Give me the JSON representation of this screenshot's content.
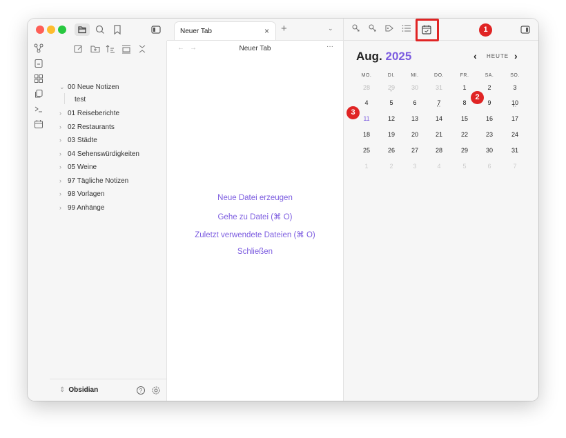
{
  "sidebar": {
    "vault_name": "Obsidian",
    "tree": [
      {
        "label": "00 Neue Notizen",
        "expanded": true
      },
      {
        "label": "test",
        "is_file": true
      },
      {
        "label": "01 Reiseberichte"
      },
      {
        "label": "02 Restaurants"
      },
      {
        "label": "03 Städte"
      },
      {
        "label": "04 Sehenswürdigkeiten"
      },
      {
        "label": "05 Weine"
      },
      {
        "label": "97 Tägliche Notizen"
      },
      {
        "label": "98 Vorlagen"
      },
      {
        "label": "99 Anhänge"
      }
    ]
  },
  "editor": {
    "tab_title": "Neuer Tab",
    "header_title": "Neuer Tab",
    "actions": [
      "Neue Datei erzeugen",
      "Gehe zu Datei (⌘ O)",
      "Zuletzt verwendete Dateien (⌘ O)",
      "Schließen"
    ]
  },
  "calendar": {
    "month": "Aug.",
    "year": "2025",
    "today_label": "HEUTE",
    "weekdays": [
      "MO.",
      "DI.",
      "MI.",
      "DO.",
      "FR.",
      "SA.",
      "SO."
    ],
    "weeks": [
      [
        "28",
        "29",
        "30",
        "31",
        "1",
        "2",
        "3"
      ],
      [
        "4",
        "5",
        "6",
        "7",
        "8",
        "9",
        "10"
      ],
      [
        "11",
        "12",
        "13",
        "14",
        "15",
        "16",
        "17"
      ],
      [
        "18",
        "19",
        "20",
        "21",
        "22",
        "23",
        "24"
      ],
      [
        "25",
        "26",
        "27",
        "28",
        "29",
        "30",
        "31"
      ],
      [
        "1",
        "2",
        "3",
        "4",
        "5",
        "6",
        "7"
      ]
    ],
    "today": "11"
  },
  "annotations": [
    "1",
    "2",
    "3"
  ],
  "colors": {
    "accent": "#7c5ce0",
    "badge": "#e02424"
  }
}
